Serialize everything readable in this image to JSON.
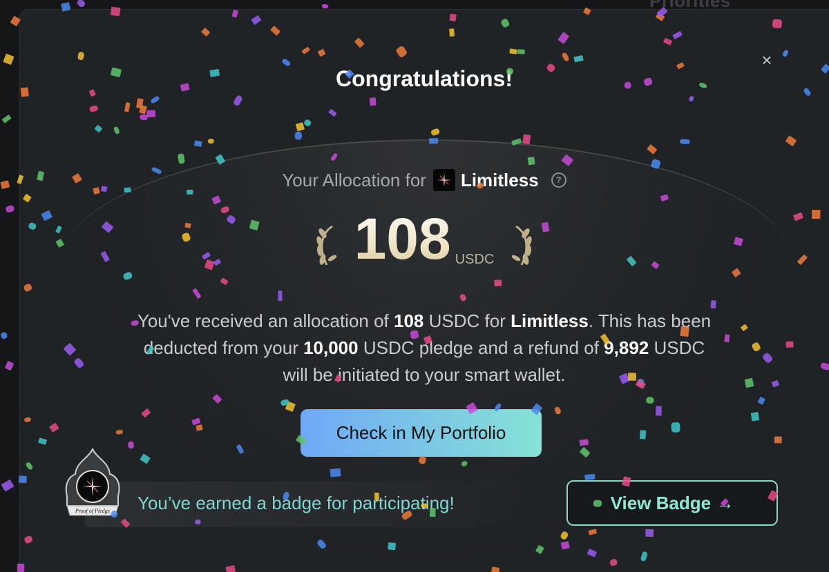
{
  "background": {
    "partial_heading": "Priorities"
  },
  "modal": {
    "title": "Congratulations!",
    "close_icon": "close-icon",
    "allocation": {
      "label": "Your Allocation for",
      "token_name": "Limitless",
      "help_icon": "question-circle-icon",
      "amount": "108",
      "unit": "USDC"
    },
    "description": {
      "p1": "You've received an allocation of ",
      "amount": "108",
      "p2": " USDC for ",
      "token": "Limitless",
      "p3": ". This has been deducted from your ",
      "pledge": "10,000",
      "p4": " USDC pledge and a refund of ",
      "refund": "9,892",
      "p5": " USDC will be initiated to your smart wallet."
    },
    "portfolio_button": "Check in My Portfolio",
    "badge": {
      "image_text": "Proof of Pledge",
      "message": "You’ve earned a badge for participating!",
      "button": "View Badge →"
    }
  },
  "colors": {
    "modal_bg": "#202326",
    "accent_gradient_start": "#6fa8f7",
    "accent_gradient_end": "#86e3d5",
    "badge_text": "#7fd6d2",
    "amount_gold": "#efe4c3"
  }
}
